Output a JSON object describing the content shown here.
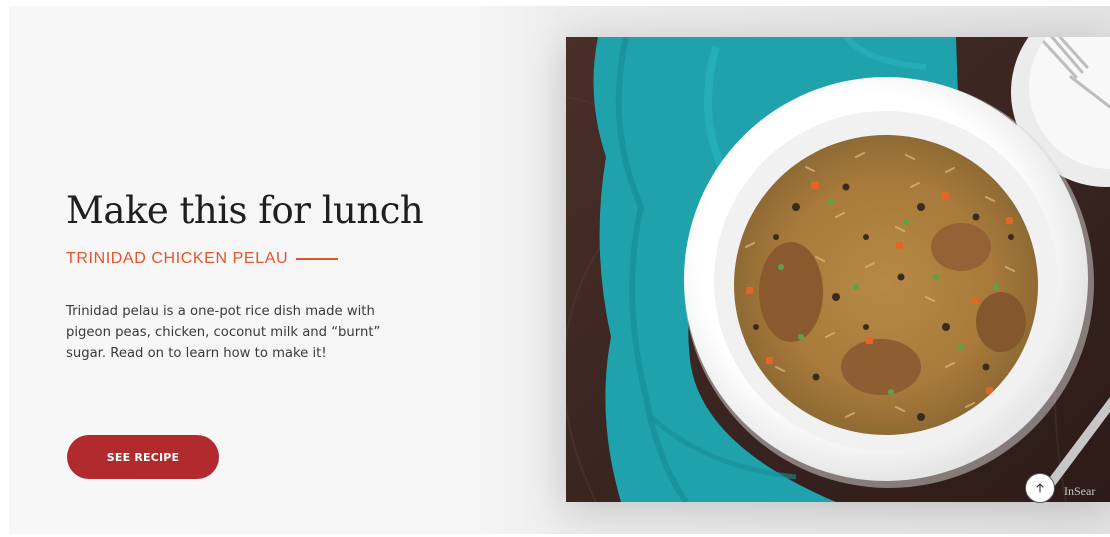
{
  "hero": {
    "headline": "Make this for lunch",
    "subtitle": "TRINIDAD CHICKEN PELAU",
    "description": "Trinidad pelau is a one-pot rice dish made with pigeon peas, chicken, coconut milk and “burnt” sugar. Read on to learn how to make it!",
    "cta_label": "SEE RECIPE"
  },
  "photo": {
    "subject": "Bowl of Trinidad chicken pelau on a teal napkin with a plate and fork",
    "watermark": "InSear"
  },
  "scroll_top": {
    "icon": "arrow-up-icon"
  },
  "colors": {
    "accent_orange": "#e2552b",
    "button_red": "#b02a2e",
    "heading": "#1f1f1f",
    "body_text": "#3a3a3a",
    "napkin_teal": "#20a2ad",
    "wood_dark": "#3a2521"
  }
}
